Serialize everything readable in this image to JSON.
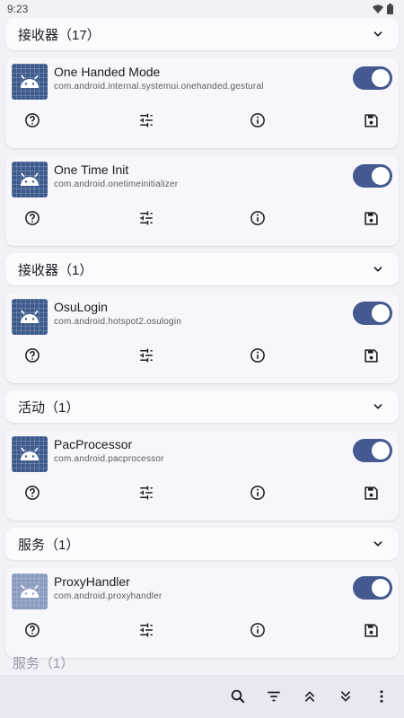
{
  "status_bar": {
    "time": "9:23"
  },
  "groups": [
    {
      "title": "接收器（17）"
    },
    {
      "title": "接收器（1）"
    },
    {
      "title": "活动（1）"
    },
    {
      "title": "服务（1）"
    },
    {
      "title": "服务（1）"
    }
  ],
  "components": [
    {
      "name": "One Handed Mode",
      "package": "com.android.internal.systemui.onehanded.gestural",
      "enabled": true
    },
    {
      "name": "One Time Init",
      "package": "com.android.onetimeinitializer",
      "enabled": true
    },
    {
      "name": "OsuLogin",
      "package": "com.android.hotspot2.osulogin",
      "enabled": true
    },
    {
      "name": "PacProcessor",
      "package": "com.android.pacprocessor",
      "enabled": true
    },
    {
      "name": "ProxyHandler",
      "package": "com.android.proxyhandler",
      "enabled": true
    }
  ],
  "card_actions": [
    "help-icon",
    "tune-icon",
    "info-icon",
    "save-icon"
  ],
  "bottom_bar": [
    "search-icon",
    "filter-icon",
    "collapse-all-icon",
    "expand-all-icon",
    "more-vert-icon"
  ],
  "colors": {
    "accent": "#44598f",
    "background": "#f3f1f8",
    "card": "#f7f6fb",
    "app_icon": "#3d5a8c"
  }
}
